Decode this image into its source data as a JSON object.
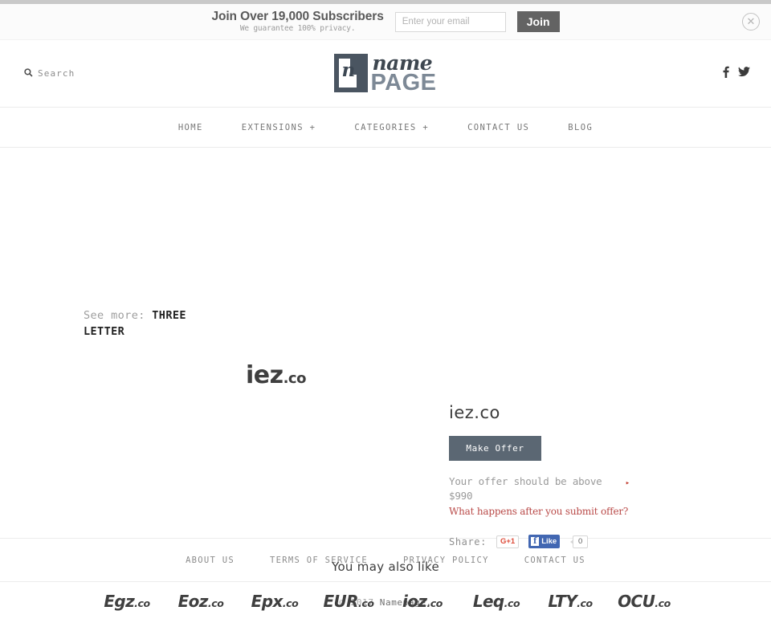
{
  "banner": {
    "title": "Join Over 19,000 Subscribers",
    "subtitle": "We guarantee 100% privacy.",
    "email_placeholder": "Enter your email",
    "email_value": "",
    "join_label": "Join",
    "close_glyph": "✕"
  },
  "header": {
    "search_label": "Search",
    "search_glyph": "⌕",
    "logo": {
      "mark_letter": "n",
      "word_top": "name",
      "word_bottom": "PAGE"
    },
    "socials": [
      {
        "name": "facebook-icon",
        "glyph": "f"
      },
      {
        "name": "twitter-icon",
        "glyph": "✉"
      }
    ]
  },
  "nav": {
    "items": [
      {
        "label": "HOME"
      },
      {
        "label": "EXTENSIONS +"
      },
      {
        "label": "CATEGORIES +"
      },
      {
        "label": "CONTACT US"
      },
      {
        "label": "BLOG"
      }
    ]
  },
  "main": {
    "see_more_label": "See more:",
    "see_more_value": "THREE LETTER",
    "domain_art_name": "iez",
    "domain_art_tld": ".co",
    "detail": {
      "title": "iez.co",
      "offer_button": "Make Offer",
      "offer_note": "Your offer should be above $990",
      "note_arrow": "▸",
      "offer_link": "What happens after you submit offer?",
      "share_label": "Share:",
      "gplus_label": "G+1",
      "fb_f": "f",
      "fb_like_label": "Like",
      "fb_count": "0"
    },
    "also_title": "You may also like",
    "also_items": [
      {
        "name": "Egz",
        "tld": ".co"
      },
      {
        "name": "Eoz",
        "tld": ".co"
      },
      {
        "name": "Epx",
        "tld": ".co"
      },
      {
        "name": "EUR",
        "tld": ".co"
      },
      {
        "name": "ioz",
        "tld": ".co"
      },
      {
        "name": "Leq",
        "tld": ".co"
      },
      {
        "name": "LTY",
        "tld": ".co"
      },
      {
        "name": "OCU",
        "tld": ".co"
      }
    ]
  },
  "footer": {
    "links": [
      {
        "label": "ABOUT US"
      },
      {
        "label": "TERMS OF SERVICE"
      },
      {
        "label": "PRIVACY POLICY"
      },
      {
        "label": "CONTACT US"
      }
    ],
    "copyright_prefix": "© 2017 ",
    "copyright_brand": "Namepage."
  },
  "colors": {
    "accent_red": "#b94a48",
    "button_slate": "#5b6773",
    "join_gray": "#636363",
    "facebook_blue": "#4267b2",
    "gplus_red": "#dd4b39"
  }
}
